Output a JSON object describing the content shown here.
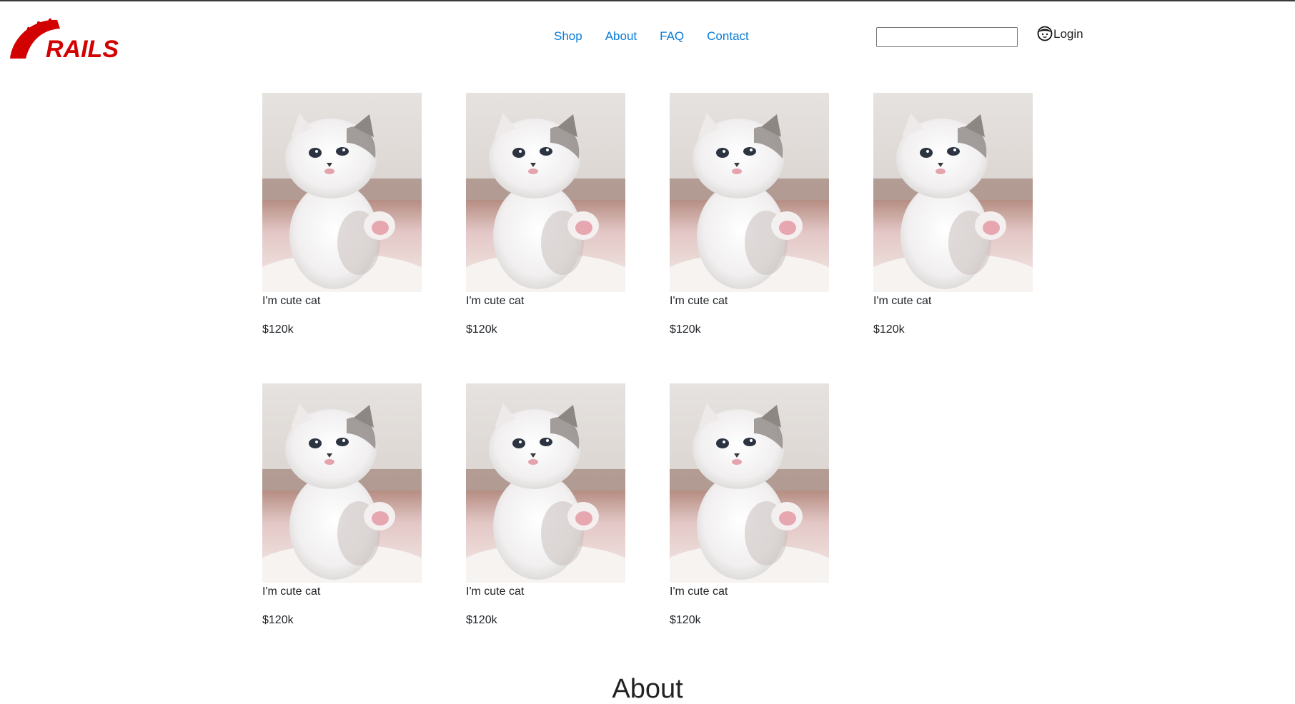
{
  "header": {
    "logo_text": "RAILS",
    "brand_color": "#d30001",
    "nav": [
      {
        "label": "Shop"
      },
      {
        "label": "About"
      },
      {
        "label": "FAQ"
      },
      {
        "label": "Contact"
      }
    ],
    "search": {
      "value": "",
      "placeholder": ""
    },
    "login_label": "Login",
    "login_icon": "user-face-icon",
    "link_color": "#0a7bd6"
  },
  "products": [
    {
      "title": "I'm cute cat",
      "price": "$120k"
    },
    {
      "title": "I'm cute cat",
      "price": "$120k"
    },
    {
      "title": "I'm cute cat",
      "price": "$120k"
    },
    {
      "title": "I'm cute cat",
      "price": "$120k"
    },
    {
      "title": "I'm cute cat",
      "price": "$120k"
    },
    {
      "title": "I'm cute cat",
      "price": "$120k"
    },
    {
      "title": "I'm cute cat",
      "price": "$120k"
    }
  ],
  "about": {
    "heading": "About"
  }
}
